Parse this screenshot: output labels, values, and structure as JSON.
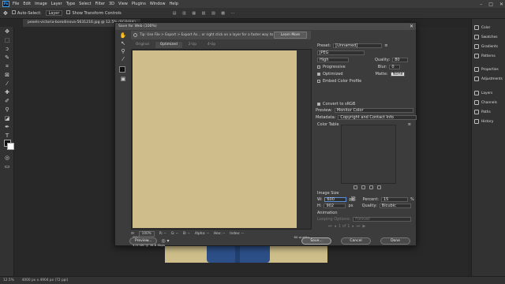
{
  "app": {
    "menu": [
      "File",
      "Edit",
      "Image",
      "Layer",
      "Type",
      "Select",
      "Filter",
      "3D",
      "View",
      "Plugins",
      "Window",
      "Help"
    ],
    "logo": "Ps"
  },
  "options": {
    "auto_select": "Auto-Select:",
    "layer": "Layer",
    "show_transform": "Show Transform Controls"
  },
  "document_tab": "pexels-victoria-borodinova-5631216.jpg @ 12.5% (RGB/8#)",
  "panels": [
    "Color",
    "Swatches",
    "Gradients",
    "Patterns",
    "Properties",
    "Adjustments",
    "Layers",
    "Channels",
    "Paths",
    "History"
  ],
  "status": {
    "zoom": "12.5%",
    "doc": "4000 px x 4904 px (72 ppi)"
  },
  "dialog": {
    "title": "Save for Web (100%)",
    "tip": "Tip: Use File > Export > Export As... or right click on a layer for a faster way to export assets",
    "learn_more": "Learn More",
    "tabs": [
      "Original",
      "Optimized",
      "2-Up",
      "4-Up"
    ],
    "active_tab": "Optimized",
    "preview_info_left": [
      "JPEG",
      "1.284M",
      "470 sec @ 56.6 Kbps"
    ],
    "preview_info_right": "80 quality",
    "zoom": "100%",
    "info_bar": [
      "R: --",
      "G: --",
      "B: --",
      "Alpha: --",
      "Hex: --",
      "Index: --"
    ],
    "preview_button": "Preview...",
    "save_button": "Save...",
    "cancel_button": "Cancel",
    "done_button": "Done",
    "preset_label": "Preset:",
    "preset_value": "[Unnamed]",
    "format": "JPEG",
    "quality_level": "High",
    "quality_label": "Quality:",
    "quality_value": "80",
    "progressive": "Progressive",
    "blur_label": "Blur:",
    "blur_value": "0",
    "optimized": "Optimized",
    "matte_label": "Matte:",
    "matte_value": "None",
    "embed_profile": "Embed Color Profile",
    "convert_srgb": "Convert to sRGB",
    "preview_label": "Preview:",
    "preview_value": "Monitor Color",
    "metadata_label": "Metadata:",
    "metadata_value": "Copyright and Contact Info",
    "color_table": "Color Table",
    "image_size": "Image Size",
    "w_label": "W:",
    "w_value": "600",
    "h_label": "H:",
    "h_value": "902",
    "px": "px",
    "percent_label": "Percent:",
    "percent_value": "15",
    "percent_unit": "%",
    "quality2_label": "Quality:",
    "quality2_value": "Bicubic",
    "animation": "Animation",
    "looping_label": "Looping Options:",
    "looping_value": "Forever",
    "frames": "1 of 1"
  }
}
